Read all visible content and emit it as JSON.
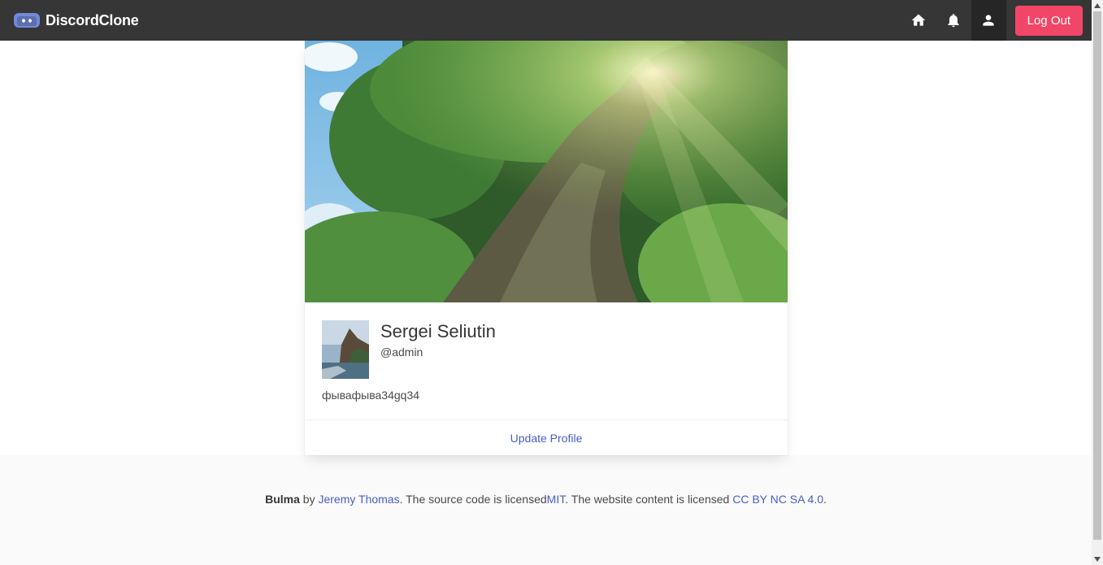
{
  "navbar": {
    "brand_name": "DiscordClone",
    "icons": [
      "home-icon",
      "bell-icon",
      "user-icon"
    ],
    "logout_label": "Log Out"
  },
  "profile": {
    "name": "Sergei Seliutin",
    "handle": "@admin",
    "bio": "фывафыва34gq34",
    "update_label": "Update Profile"
  },
  "footer": {
    "brand": "Bulma",
    "by": " by ",
    "author": "Jeremy Thomas",
    "source_text": ". The source code is licensed",
    "license_code": "MIT",
    "content_text": ". The website content is licensed ",
    "license_content": "CC BY NC SA 4.0",
    "end": "."
  },
  "colors": {
    "navbar_bg": "#363636",
    "danger": "#f14668",
    "link": "#485fc7",
    "footer_bg": "#fafafa",
    "brand_logo": "#7289da"
  }
}
